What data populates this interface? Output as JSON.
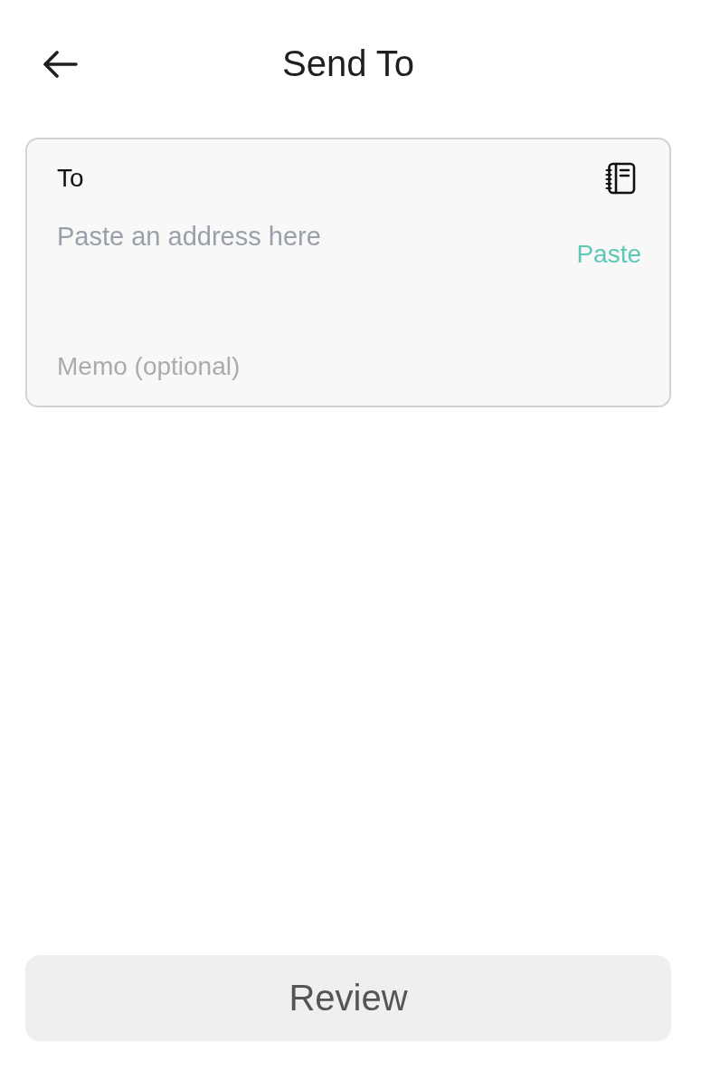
{
  "header": {
    "title": "Send To"
  },
  "recipient": {
    "label": "To",
    "address": {
      "placeholder": "Paste an address here"
    },
    "paste_button": "Paste",
    "memo": {
      "placeholder": "Memo (optional)"
    }
  },
  "review_button": {
    "label": "Review",
    "disabled": true
  }
}
